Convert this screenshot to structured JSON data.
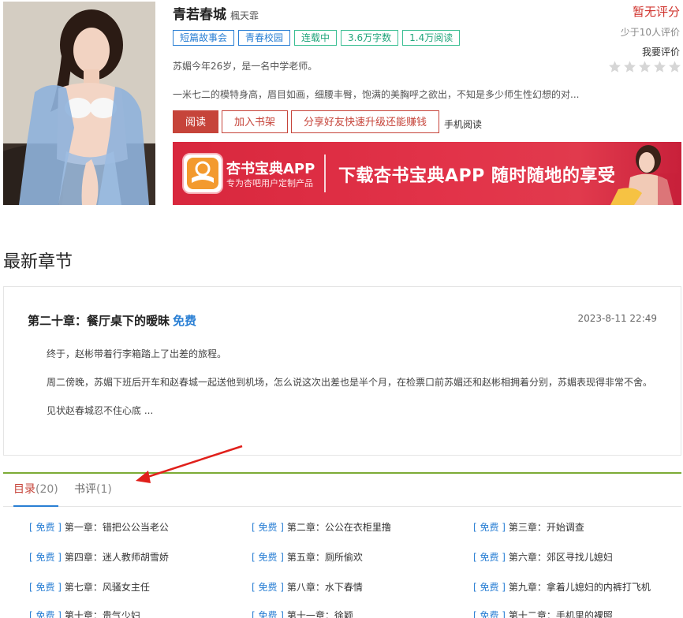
{
  "book": {
    "title": "青若春城",
    "author": "楓天霏",
    "tags": [
      "短篇故事会",
      "青春校园",
      "连载中",
      "3.6万字数",
      "1.4万阅读"
    ],
    "intro_line1": "苏媚今年26岁，是一名中学老师。",
    "intro_line2": "一米七二的模特身高，眉目如画，细腰丰臀，饱满的美胸呼之欲出，不知是多少师生性幻想的对...",
    "actions": {
      "read": "阅读",
      "add_shelf": "加入书架",
      "share": "分享好友快速升级还能赚钱",
      "mobile_read": "手机阅读"
    }
  },
  "rating": {
    "title": "暂无评分",
    "count_note": "少于10人评价",
    "rate_me": "我要评价",
    "stars": 0
  },
  "banner": {
    "app_name": "杏书宝典APP",
    "app_sub": "专为杏吧用户定制产品",
    "slogan": "下载杏书宝典APP 随时随地的享受"
  },
  "latest": {
    "section_title": "最新章节",
    "chapter_title": "第二十章：餐厅桌下的暧昧",
    "free_label": "免费",
    "date": "2023-8-11 22:49",
    "paragraphs": [
      "终于，赵彬带着行李箱踏上了出差的旅程。",
      "周二傍晚，苏媚下班后开车和赵春城一起送他到机场，怎么说这次出差也是半个月，在检票口前苏媚还和赵彬相拥着分别，苏媚表现得非常不舍。",
      "见状赵春城忍不住心底 ..."
    ]
  },
  "tabs": [
    {
      "label": "目录",
      "count": "(20)"
    },
    {
      "label": "书评",
      "count": "(1)"
    }
  ],
  "chapters": [
    {
      "free": "[ 免费 ]",
      "title": "第一章：错把公公当老公"
    },
    {
      "free": "[ 免费 ]",
      "title": "第二章：公公在衣柜里撸"
    },
    {
      "free": "[ 免费 ]",
      "title": "第三章：开始调查"
    },
    {
      "free": "[ 免费 ]",
      "title": "第四章：迷人教师胡雪娇"
    },
    {
      "free": "[ 免费 ]",
      "title": "第五章：厕所偷欢"
    },
    {
      "free": "[ 免费 ]",
      "title": "第六章：郊区寻找儿媳妇"
    },
    {
      "free": "[ 免费 ]",
      "title": "第七章：风骚女主任"
    },
    {
      "free": "[ 免费 ]",
      "title": "第八章：水下春情"
    },
    {
      "free": "[ 免费 ]",
      "title": "第九章：拿着儿媳妇的内裤打飞机"
    },
    {
      "free": "[ 免费 ]",
      "title": "第十章：贵气少妇"
    },
    {
      "free": "[ 免费 ]",
      "title": "第十一章：徐颖"
    },
    {
      "free": "[ 免费 ]",
      "title": "第十二章：手机里的裸照"
    }
  ],
  "colors": {
    "accent_red": "#c6443a",
    "link_blue": "#2a7fd4",
    "tag_green": "#21a57b",
    "tab_line_green": "#7cab36"
  }
}
